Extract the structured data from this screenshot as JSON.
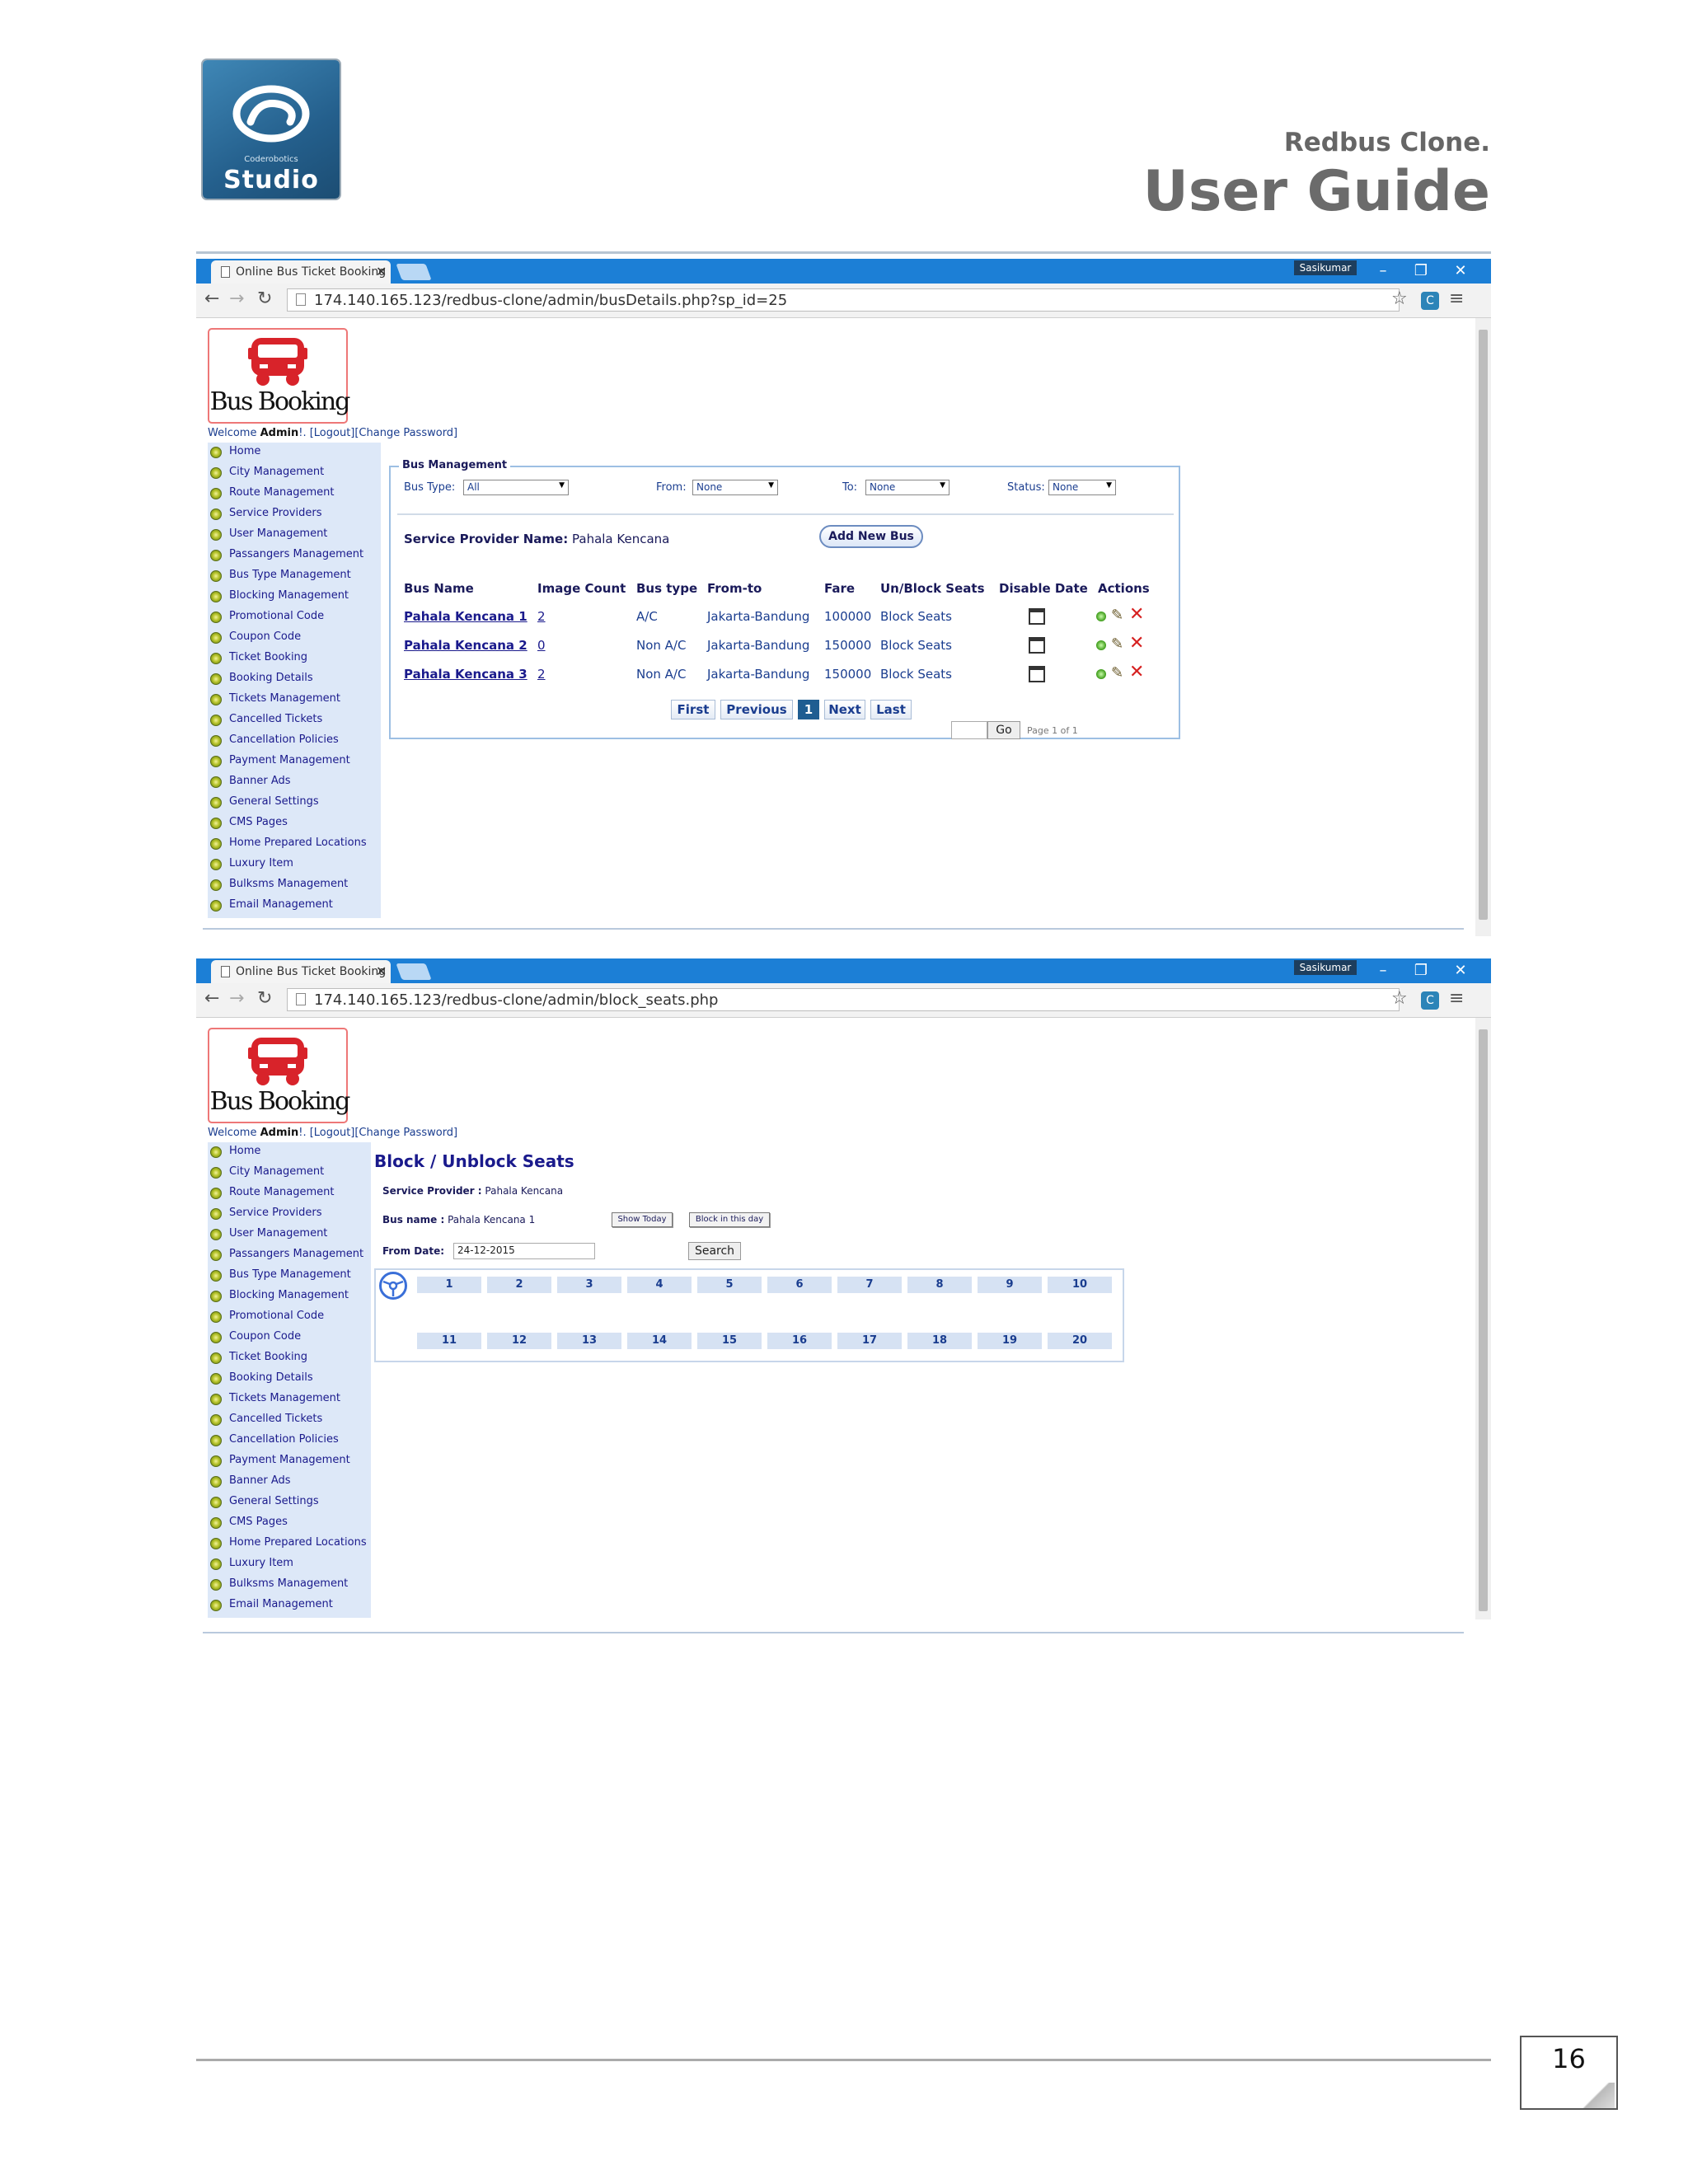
{
  "doc": {
    "logo_small": "Coderobotics",
    "logo_text": "Studio",
    "subtitle": "Redbus Clone.",
    "title": "User Guide",
    "page_number": "16"
  },
  "browser1": {
    "tab_title": "Online Bus Ticket Booking",
    "user": "Sasikumar",
    "url": "174.140.165.123/redbus-clone/admin/busDetails.php?sp_id=25"
  },
  "browser2": {
    "tab_title": "Online Bus Ticket Booking",
    "user": "Sasikumar",
    "url": "174.140.165.123/redbus-clone/admin/block_seats.php"
  },
  "app": {
    "logo_text": "Bus Booking",
    "welcome": "Welcome ",
    "admin": "Admin",
    "welcome_rest": "!. [Logout][Change Password]"
  },
  "sidebar": {
    "items": [
      "Home",
      "City Management",
      "Route Management",
      "Service Providers",
      "User Management",
      "Passangers Management",
      "Bus Type Management",
      "Blocking Management",
      "Promotional Code",
      "Coupon Code",
      "Ticket Booking",
      "Booking Details",
      "Tickets Management",
      "Cancelled Tickets",
      "Cancellation Policies",
      "Payment Management",
      "Banner Ads",
      "General Settings",
      "CMS Pages",
      "Home Prepared Locations",
      "Luxury Item",
      "Bulksms Management",
      "Email Management"
    ]
  },
  "bus_mgmt": {
    "legend": "Bus Management",
    "filters": {
      "bus_type_label": "Bus Type:",
      "bus_type_value": "All",
      "from_label": "From:",
      "from_value": "None",
      "to_label": "To:",
      "to_value": "None",
      "status_label": "Status:",
      "status_value": "None"
    },
    "sp_label": "Service Provider Name:",
    "sp_value": "Pahala Kencana",
    "add_button": "Add New Bus",
    "columns": [
      "Bus Name",
      "Image Count",
      "Bus type",
      "From-to",
      "Fare",
      "Un/Block Seats",
      "Disable Date",
      "Actions"
    ],
    "rows": [
      {
        "name": "Pahala Kencana 1",
        "images": "2",
        "type": "A/C",
        "route": "Jakarta-Bandung",
        "fare": "100000",
        "block": "Block Seats"
      },
      {
        "name": "Pahala Kencana 2",
        "images": "0",
        "type": "Non A/C",
        "route": "Jakarta-Bandung",
        "fare": "150000",
        "block": "Block Seats"
      },
      {
        "name": "Pahala Kencana 3",
        "images": "2",
        "type": "Non A/C",
        "route": "Jakarta-Bandung",
        "fare": "150000",
        "block": "Block Seats"
      }
    ],
    "pager": {
      "first": "First",
      "previous": "Previous",
      "current": "1",
      "next": "Next",
      "last": "Last",
      "go": "Go",
      "page_of": "Page 1 of 1"
    }
  },
  "block": {
    "title": "Block / Unblock Seats",
    "sp_label": "Service Provider :",
    "sp_value": " Pahala Kencana",
    "bus_label": "Bus name :",
    "bus_value": " Pahala Kencana 1",
    "show_today": "Show Today",
    "block_day": "Block in this day",
    "from_label": "From Date:",
    "from_value": "24-12-2015",
    "search": "Search",
    "seats_row1": [
      "1",
      "2",
      "3",
      "4",
      "5",
      "6",
      "7",
      "8",
      "9",
      "10"
    ],
    "seats_row2": [
      "11",
      "12",
      "13",
      "14",
      "15",
      "16",
      "17",
      "18",
      "19",
      "20"
    ]
  },
  "colors": {
    "chrome_blue": "#1c7fd6",
    "sidebar_bg": "#dde8f8",
    "link": "#1a1a8c",
    "delete": "#d62020"
  }
}
